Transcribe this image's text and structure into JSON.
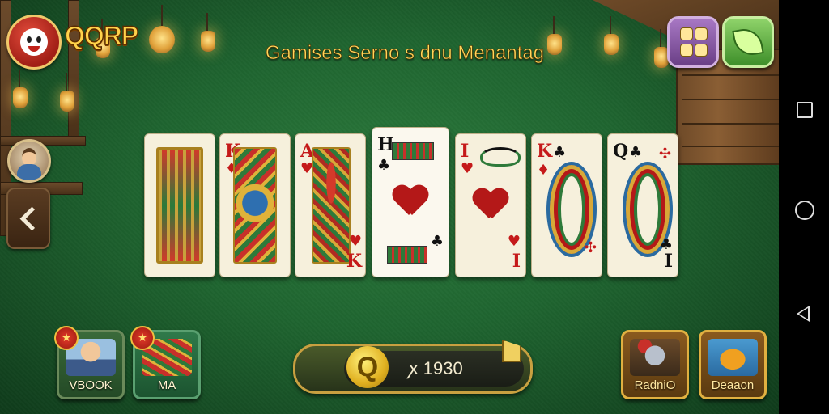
{
  "header": {
    "logo_text": "QQRP",
    "title": "Gamises Serno s dnu Menantag"
  },
  "top_buttons": {
    "menu_icon": "grid-icon",
    "leaf_icon": "leaf-icon"
  },
  "cards": [
    {
      "index_top": "",
      "index_bottom": "",
      "suit": "",
      "color": "red",
      "face": "card-back"
    },
    {
      "index_top": "K",
      "index_bottom": "",
      "suit": "♦",
      "color": "red",
      "face": "court"
    },
    {
      "index_top": "A",
      "index_bottom": "K",
      "suit": "♥",
      "color": "red",
      "face": "court"
    },
    {
      "index_top": "H",
      "index_bottom": "",
      "suit": "♣",
      "color": "black",
      "face": "heart-center"
    },
    {
      "index_top": "I",
      "index_bottom": "I",
      "suit": "♥",
      "color": "red",
      "face": "heart-center"
    },
    {
      "index_top": "K",
      "index_bottom": "",
      "suit": "♣",
      "color": "red",
      "face": "swirl"
    },
    {
      "index_top": "Q",
      "index_bottom": "I",
      "suit": "♣",
      "color": "black",
      "face": "swirl"
    }
  ],
  "bottom_left": [
    {
      "label": "VBOOK",
      "icon": "portrait-icon",
      "badge": "★"
    },
    {
      "label": "MA",
      "icon": "scarf-icon",
      "badge": "★"
    }
  ],
  "bottom_right": [
    {
      "label": "RadniO",
      "icon": "knight-icon"
    },
    {
      "label": "Deaaon",
      "icon": "fish-icon"
    }
  ],
  "coins": {
    "symbol": "Q",
    "value": "ꭗ 1930"
  }
}
